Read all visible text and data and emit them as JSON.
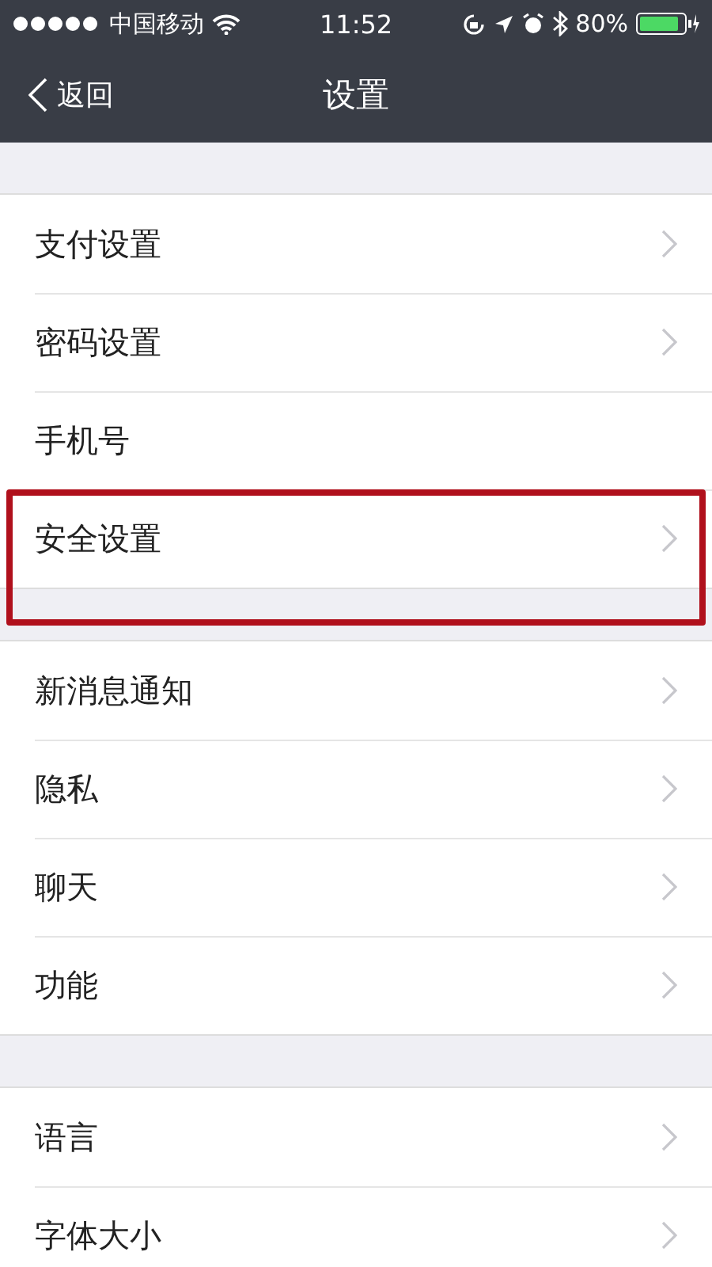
{
  "status_bar": {
    "carrier": "中国移动",
    "time": "11:52",
    "battery": "80%"
  },
  "nav_bar": {
    "back": "返回",
    "title": "设置"
  },
  "groups": [
    {
      "items": [
        {
          "label": "支付设置",
          "chevron": true,
          "highlighted": false
        },
        {
          "label": "密码设置",
          "chevron": true,
          "highlighted": false
        },
        {
          "label": "手机号",
          "chevron": false,
          "highlighted": false
        },
        {
          "label": "安全设置",
          "chevron": true,
          "highlighted": true
        }
      ]
    },
    {
      "items": [
        {
          "label": "新消息通知",
          "chevron": true,
          "highlighted": false
        },
        {
          "label": "隐私",
          "chevron": true,
          "highlighted": false
        },
        {
          "label": "聊天",
          "chevron": true,
          "highlighted": false
        },
        {
          "label": "功能",
          "chevron": true,
          "highlighted": false
        }
      ]
    },
    {
      "items": [
        {
          "label": "语言",
          "chevron": true,
          "highlighted": false
        },
        {
          "label": "字体大小",
          "chevron": true,
          "highlighted": false
        }
      ]
    }
  ]
}
